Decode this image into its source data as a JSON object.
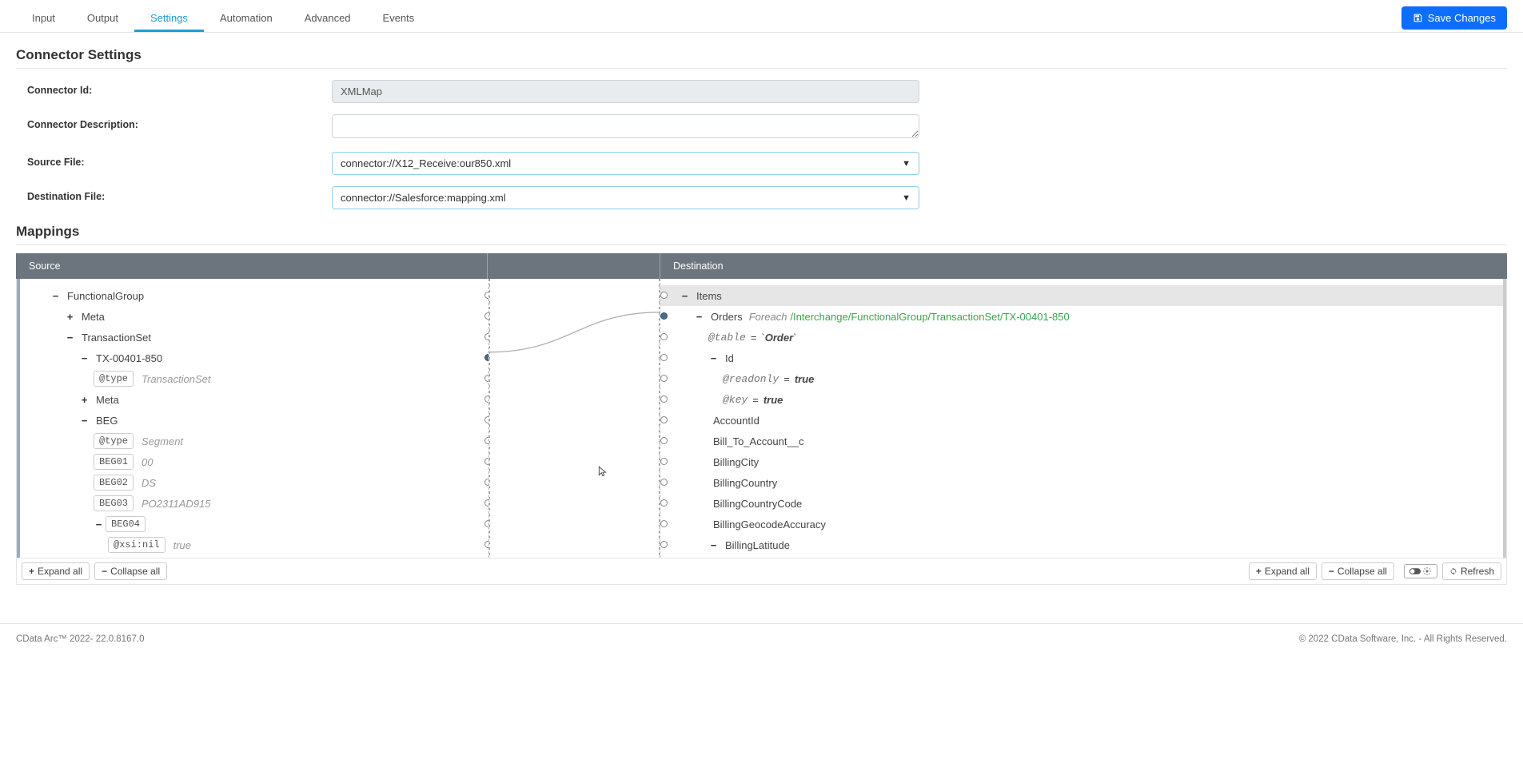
{
  "tabs": {
    "items": [
      "Input",
      "Output",
      "Settings",
      "Automation",
      "Advanced",
      "Events"
    ],
    "active": "Settings"
  },
  "save_button": "Save Changes",
  "sections": {
    "connector_settings": {
      "title": "Connector Settings",
      "fields": {
        "connector_id": {
          "label": "Connector Id:",
          "value": "XMLMap"
        },
        "connector_description": {
          "label": "Connector Description:",
          "value": ""
        },
        "source_file": {
          "label": "Source File:",
          "value": "connector://X12_Receive:our850.xml"
        },
        "destination_file": {
          "label": "Destination File:",
          "value": "connector://Salesforce:mapping.xml"
        }
      }
    },
    "mappings": {
      "title": "Mappings",
      "columns": {
        "source": "Source",
        "destination": "Destination"
      },
      "source_tree": [
        {
          "ind": 1,
          "t": "minus",
          "label": "FunctionalGroup"
        },
        {
          "ind": 2,
          "t": "plus",
          "label": "Meta"
        },
        {
          "ind": 2,
          "t": "minus",
          "label": "TransactionSet"
        },
        {
          "ind": 3,
          "t": "minus",
          "label": "TX-00401-850"
        },
        {
          "ind": 4,
          "chip": "@type",
          "italic": "TransactionSet"
        },
        {
          "ind": 3,
          "t": "plus",
          "label": "Meta"
        },
        {
          "ind": 3,
          "t": "minus",
          "label": "BEG"
        },
        {
          "ind": 4,
          "chip": "@type",
          "italic": "Segment"
        },
        {
          "ind": 4,
          "chip": "BEG01",
          "italic": "00"
        },
        {
          "ind": 4,
          "chip": "BEG02",
          "italic": "DS"
        },
        {
          "ind": 4,
          "chip": "BEG03",
          "italic": "PO2311AD915"
        },
        {
          "ind": 4,
          "t": "minus",
          "chip": "BEG04"
        },
        {
          "ind": 5,
          "chip": "@xsi:nil",
          "italic": "true"
        }
      ],
      "dest_tree": [
        {
          "ind": 0,
          "t": "minus",
          "label": "Items",
          "hover": true
        },
        {
          "ind": 1,
          "t": "minus",
          "label": "Orders",
          "foreach": "Foreach",
          "path": "/Interchange/FunctionalGroup/TransactionSet/TX-00401-850"
        },
        {
          "ind": 2,
          "italic_attr": "@table",
          "eq": "=",
          "tick": "`Order`"
        },
        {
          "ind": 2,
          "t": "minus",
          "label": "Id"
        },
        {
          "ind": 3,
          "italic_attr": "@readonly",
          "eq": "=",
          "boldval": "true"
        },
        {
          "ind": 3,
          "italic_attr": "@key",
          "eq": "=",
          "boldval": "true"
        },
        {
          "ind": 2,
          "label": "AccountId"
        },
        {
          "ind": 2,
          "label": "Bill_To_Account__c"
        },
        {
          "ind": 2,
          "label": "BillingCity"
        },
        {
          "ind": 2,
          "label": "BillingCountry"
        },
        {
          "ind": 2,
          "label": "BillingCountryCode"
        },
        {
          "ind": 2,
          "label": "BillingGeocodeAccuracy"
        },
        {
          "ind": 2,
          "t": "minus",
          "label": "BillingLatitude"
        }
      ],
      "buttons": {
        "expand_all": "Expand all",
        "collapse_all": "Collapse all",
        "refresh": "Refresh"
      }
    }
  },
  "footer": {
    "left": "CData Arc™ 2022- 22.0.8167.0",
    "right": "© 2022 CData Software, Inc. - All Rights Reserved."
  }
}
